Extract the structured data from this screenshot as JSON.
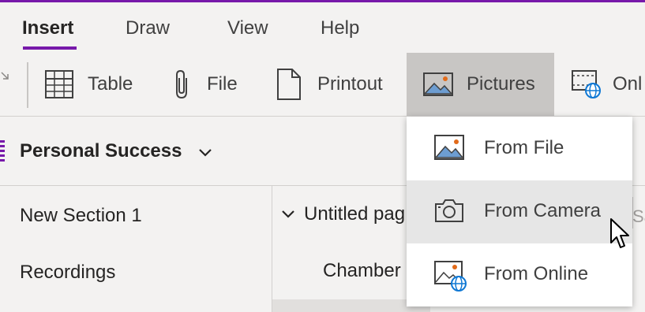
{
  "colors": {
    "accent": "#7719aa",
    "ribbon_bg": "#f3f2f1",
    "selected": "#c8c6c4",
    "menu_hover": "#e6e6e6",
    "globe": "#0f78d4",
    "sun": "#e26b1a"
  },
  "tabs": [
    {
      "label": "Insert",
      "active": true
    },
    {
      "label": "Draw",
      "active": false
    },
    {
      "label": "View",
      "active": false
    },
    {
      "label": "Help",
      "active": false
    }
  ],
  "ribbon": {
    "table_label": "Table",
    "file_label": "File",
    "printout_label": "Printout",
    "pictures_label": "Pictures",
    "online_label": "Onl"
  },
  "notebook": {
    "title": "Personal Success"
  },
  "sections": [
    "New Section 1",
    "Recordings"
  ],
  "pages": {
    "group": "Untitled pag",
    "child": "Chamber",
    "peek": "Sa"
  },
  "pictures_menu": [
    {
      "label": "From File",
      "icon": "picture-icon"
    },
    {
      "label": "From Camera",
      "icon": "camera-icon"
    },
    {
      "label": "From Online",
      "icon": "online-picture-icon"
    }
  ]
}
